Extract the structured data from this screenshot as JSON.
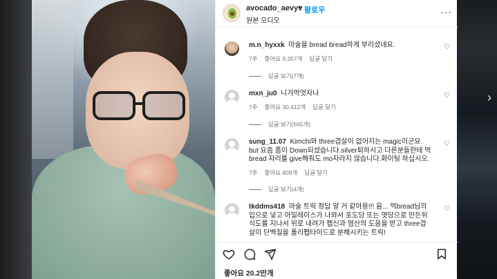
{
  "post": {
    "username": "avocado_aevyv",
    "separator": "•",
    "follow_label": "팔로우",
    "audio_label": "원본 오디오",
    "more_label": "···",
    "likes_label": "좋아요 20.2만개"
  },
  "comments": [
    {
      "username": "m.n_hyxxk",
      "text": "마술을 bread bread하게 부리셨네요.",
      "time": "7주",
      "likes": "좋아요 9,357개",
      "reply": "답글 달기",
      "replies": "답글 보기(7개)"
    },
    {
      "username": "mxn_ju0",
      "text": "니가먹엇자나",
      "time": "7주",
      "likes": "좋아요 30,412개",
      "reply": "답글 달기",
      "replies": "답글 보기(565개)"
    },
    {
      "username": "sung_11.07",
      "text": "Kimchi와 three겹살이 없어지는 magic이군요 but 요즘 폼이 Down되셨습니다.silver퇴하시고 다른분들한테 먹bread 자리를 give해줘도 mo자라지 않습니다.화이팅 하십시오.",
      "time": "7주",
      "likes": "좋아요 809개",
      "reply": "답글 달기",
      "replies": "답글 보기(4개)"
    },
    {
      "username": "tkddms418",
      "text": "마술 트릭 정답 알 거 같아용!!! 음... 먹bread님의 입으로 넣고 아밀레이스가 나와서 포도당 또는 엿당으로 만든뒤 식도를 지나서 위로 내려가 펩신과 염산의 도움을 받고 three겹살이 단백질을 폴리펩타이드로 분해시키는 트릭!"
    }
  ],
  "icons": {
    "heart": "heart-icon",
    "comment": "comment-icon",
    "share": "share-icon",
    "bookmark": "bookmark-icon",
    "next": "chevron-right-icon"
  },
  "colors": {
    "accent": "#0095f6",
    "text": "#262626",
    "muted": "#737373"
  }
}
